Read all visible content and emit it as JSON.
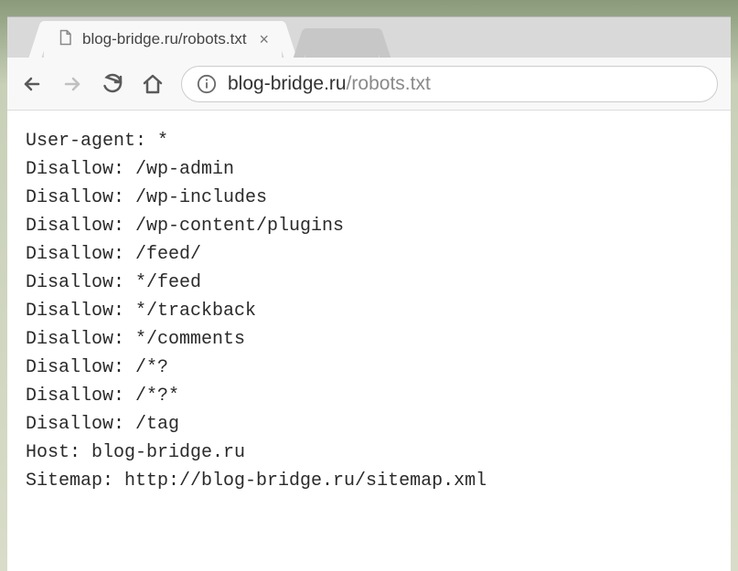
{
  "tab": {
    "title": "blog-bridge.ru/robots.txt"
  },
  "address": {
    "host": "blog-bridge.ru",
    "path": "/robots.txt"
  },
  "robots": {
    "lines": [
      "User-agent: *",
      "Disallow: /wp-admin",
      "Disallow: /wp-includes",
      "Disallow: /wp-content/plugins",
      "Disallow: /feed/",
      "Disallow: */feed",
      "Disallow: */trackback",
      "Disallow: */comments",
      "Disallow: /*?",
      "Disallow: /*?*",
      "Disallow: /tag",
      "Host: blog-bridge.ru",
      "Sitemap: http://blog-bridge.ru/sitemap.xml"
    ]
  }
}
